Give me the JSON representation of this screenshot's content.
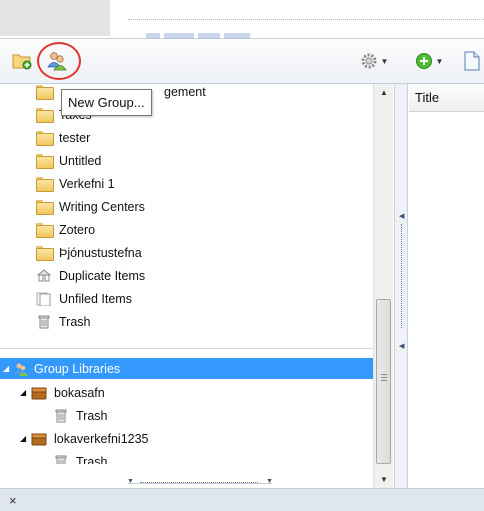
{
  "toolbar": {
    "new_collection_icon": "folder-add-icon",
    "new_group_icon": "users-group-icon",
    "actions_icon": "gear-icon",
    "new_item_icon": "green-plus-icon",
    "document_icon": "document-icon",
    "highlight_color": "#e0342a"
  },
  "tooltip": {
    "text": "New Group..."
  },
  "collections": [
    {
      "label": "Management",
      "partial_visible": "gement",
      "type": "folder"
    },
    {
      "label": "Taxes",
      "type": "folder"
    },
    {
      "label": "tester",
      "type": "folder"
    },
    {
      "label": "Untitled",
      "type": "folder"
    },
    {
      "label": "Verkefni 1",
      "type": "folder"
    },
    {
      "label": "Writing Centers",
      "type": "folder"
    },
    {
      "label": "Zotero",
      "type": "folder"
    },
    {
      "label": "Þjónustustefna",
      "type": "folder"
    },
    {
      "label": "Duplicate Items",
      "type": "duplicates"
    },
    {
      "label": "Unfiled Items",
      "type": "unfiled"
    },
    {
      "label": "Trash",
      "type": "trash"
    }
  ],
  "groups": {
    "header": "Group Libraries",
    "libraries": [
      {
        "label": "bokasafn",
        "children": [
          {
            "label": "Trash"
          }
        ]
      },
      {
        "label": "lokaverkefni1235",
        "children": [
          {
            "label": "Trash"
          }
        ]
      }
    ]
  },
  "items_pane": {
    "column_title": "Title"
  },
  "status_bar": {
    "close_glyph": "×"
  },
  "colors": {
    "selection": "#3399ff",
    "toolbar_bg": "#eef1f5",
    "status_bg": "#dfe6ef"
  }
}
